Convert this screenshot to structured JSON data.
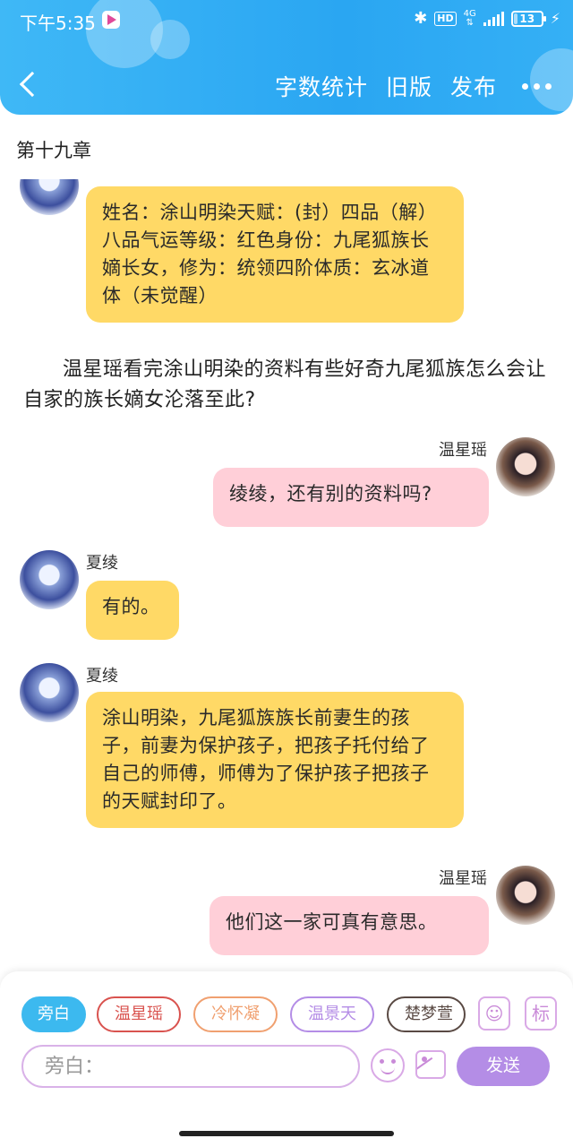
{
  "status_bar": {
    "time": "下午5:35",
    "hd": "HD",
    "network": "4G",
    "battery": "13"
  },
  "header": {
    "actions": [
      {
        "label": "字数统计"
      },
      {
        "label": "旧版"
      },
      {
        "label": "发布"
      }
    ]
  },
  "chapter_title": "第十九章",
  "messages": [
    {
      "type": "bubble",
      "side": "left",
      "speaker": "",
      "text": "姓名：涂山明染天赋：(封）四品（解）八品气运等级：红色身份：九尾狐族长嫡长女，修为：统领四阶体质：玄冰道体（未觉醒）"
    },
    {
      "type": "narration",
      "text": "温星瑶看完涂山明染的资料有些好奇九尾狐族怎么会让自家的族长嫡女沦落至此?"
    },
    {
      "type": "bubble",
      "side": "right",
      "speaker": "温星瑶",
      "text": "绫绫，还有别的资料吗?"
    },
    {
      "type": "bubble",
      "side": "left",
      "speaker": "夏绫",
      "text": "有的。"
    },
    {
      "type": "bubble",
      "side": "left",
      "speaker": "夏绫",
      "text": "涂山明染，九尾狐族族长前妻生的孩子，前妻为保护孩子，把孩子托付给了自己的师傅，师傅为了保护孩子把孩子的天赋封印了。"
    },
    {
      "type": "bubble",
      "side": "right",
      "speaker": "温星瑶",
      "text": "他们这一家可真有意思。"
    }
  ],
  "composer": {
    "characters": [
      {
        "label": "旁白",
        "color": "#3cb9ef",
        "active": true
      },
      {
        "label": "温星瑶",
        "color": "#d9534f"
      },
      {
        "label": "冷怀凝",
        "color": "#f0a070"
      },
      {
        "label": "温景天",
        "color": "#b48de6"
      },
      {
        "label": "楚梦萱",
        "color": "#5a4a44"
      }
    ],
    "tool_marker_label": "标",
    "input_placeholder": "旁白：",
    "send_label": "发送"
  }
}
